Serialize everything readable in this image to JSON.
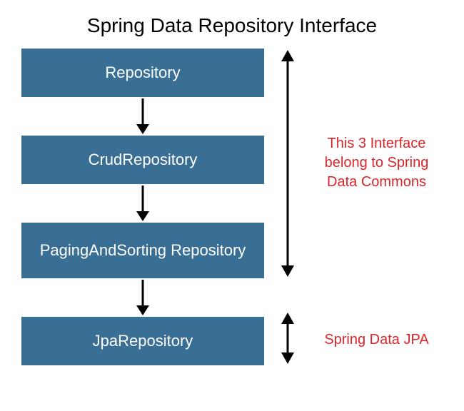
{
  "title": "Spring Data Repository Interface",
  "boxes": {
    "b1": "Repository",
    "b2": "CrudRepository",
    "b3": "PagingAndSorting Repository",
    "b4": "JpaRepository"
  },
  "annotations": {
    "commons": "This 3 Interface belong to Spring Data Commons",
    "jpa": "Spring Data JPA"
  },
  "colors": {
    "box_bg": "#3a6f95",
    "box_text": "#ffffff",
    "annotation_text": "#d9252a",
    "arrow": "#000000"
  }
}
